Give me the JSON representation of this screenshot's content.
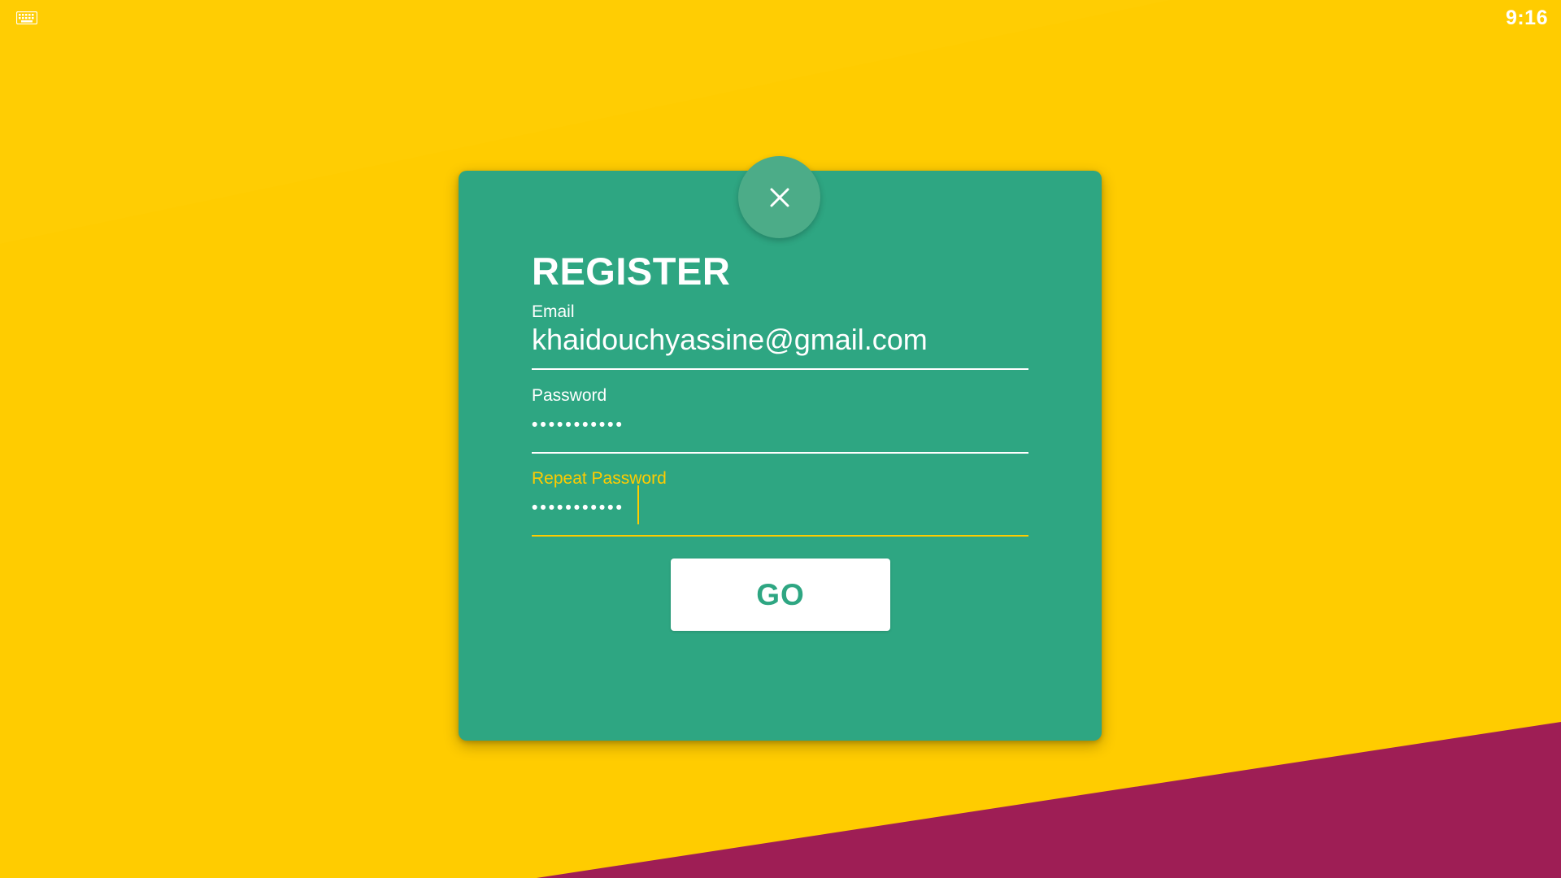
{
  "status_bar": {
    "time": "9:16",
    "keyboard_icon": "keyboard-icon"
  },
  "dialog": {
    "close_icon": "close-icon",
    "title": "REGISTER",
    "email": {
      "label": "Email",
      "value": "khaidouchyassine@gmail.com"
    },
    "password": {
      "label": "Password",
      "value": "•••••••••••"
    },
    "repeat_password": {
      "label": "Repeat Password",
      "value": "•••••••••••"
    },
    "submit_label": "GO"
  },
  "colors": {
    "background": "#FFCC00",
    "accent_shape": "#9E1E55",
    "card": "#2EA682",
    "focus": "#FFCC00"
  }
}
